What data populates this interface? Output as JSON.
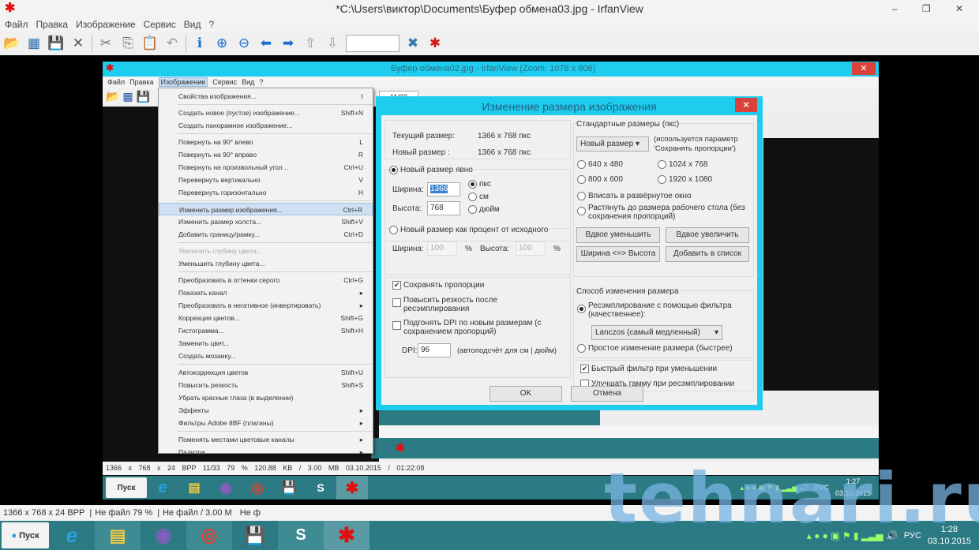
{
  "window": {
    "title": "*C:\\Users\\виктор\\Documents\\Буфер обмена03.jpg - IrfanView",
    "controls": "– ❐ ✕"
  },
  "menubar": [
    "Файл",
    "Правка",
    "Изображение",
    "Сервис",
    "Вид",
    "?"
  ],
  "toolbar": {
    "icons": [
      "open-icon",
      "thumbnails-icon",
      "save-icon",
      "delete-icon",
      "cut-icon",
      "copy-icon",
      "paste-icon",
      "undo-icon",
      "info-icon",
      "zoom-in-icon",
      "zoom-out-icon",
      "prev-icon",
      "next-icon",
      "first-page-icon",
      "last-page-icon"
    ],
    "page_value": ""
  },
  "inner": {
    "title": "Буфер обмена02.jpg - IrfanView (Zoom: 1078 x 606)",
    "menubar": [
      "Файл",
      "Правка",
      "Изображение",
      "Сервис",
      "Вид",
      "?"
    ],
    "page": "11/33",
    "status": "1366 x 768 x 24 BPP   11/33   79 %   120.88 KB / 3.00 MB   03.10.2015 / 01:22:08",
    "tray_lang": "РУС",
    "tray_time": "1:27",
    "tray_date": "03.10.2015"
  },
  "image_menu": [
    {
      "label": "Свойства изображения...",
      "shortcut": "I"
    },
    {
      "sep": true
    },
    {
      "label": "Создать новое (пустое) изображение...",
      "shortcut": "Shift+N"
    },
    {
      "label": "Создать панорамное изображение...",
      "shortcut": ""
    },
    {
      "sep": true
    },
    {
      "label": "Повернуть на 90° влево",
      "shortcut": "L"
    },
    {
      "label": "Повернуть на 90° вправо",
      "shortcut": "R"
    },
    {
      "label": "Повернуть на произвольный угол...",
      "shortcut": "Ctrl+U"
    },
    {
      "label": "Перевернуть вертикально",
      "shortcut": "V"
    },
    {
      "label": "Перевернуть горизонтально",
      "shortcut": "H"
    },
    {
      "sep": true
    },
    {
      "label": "Изменить размер изображения...",
      "shortcut": "Ctrl+R",
      "highlight": true
    },
    {
      "label": "Изменить размер холста...",
      "shortcut": "Shift+V"
    },
    {
      "label": "Добавить границу/рамку...",
      "shortcut": "Ctrl+D"
    },
    {
      "sep": true
    },
    {
      "label": "Увеличить глубину цвета...",
      "shortcut": "",
      "disabled": true
    },
    {
      "label": "Уменьшить глубину цвета...",
      "shortcut": ""
    },
    {
      "sep": true
    },
    {
      "label": "Преобразовать в оттенки серого",
      "shortcut": "Ctrl+G"
    },
    {
      "label": "Показать канал",
      "shortcut": "▸"
    },
    {
      "label": "Преобразовать в негативное (инвертировать)",
      "shortcut": "▸"
    },
    {
      "label": "Коррекция цветов...",
      "shortcut": "Shift+G"
    },
    {
      "label": "Гистограмма...",
      "shortcut": "Shift+H"
    },
    {
      "label": "Заменить цвет...",
      "shortcut": ""
    },
    {
      "label": "Создать мозаику...",
      "shortcut": ""
    },
    {
      "sep": true
    },
    {
      "label": "Автокоррекция цветов",
      "shortcut": "Shift+U"
    },
    {
      "label": "Повысить резкость",
      "shortcut": "Shift+S"
    },
    {
      "label": "Убрать красные глаза (в выделении)",
      "shortcut": ""
    },
    {
      "label": "Эффекты",
      "shortcut": "▸"
    },
    {
      "label": "Фильтры Adobe 8BF (плагины)",
      "shortcut": "▸"
    },
    {
      "sep": true
    },
    {
      "label": "Поменять местами цветовые каналы",
      "shortcut": "▸"
    },
    {
      "label": "Палитра",
      "shortcut": "▸"
    }
  ],
  "dialog": {
    "title": "Изменение размера изображения",
    "close": "✕",
    "current_label": "Текущий размер:",
    "current_value": "1366  x  768  пкс",
    "new_label": "Новый размер   :",
    "new_value": "1366  x  768  пкс",
    "explicit_label": "Новый размер явно",
    "width_label": "Ширина:",
    "width_value": "1366",
    "height_label": "Высота:",
    "height_value": "768",
    "unit_px": "пкс",
    "unit_cm": "см",
    "unit_in": "дюйм",
    "percent_label": "Новый размер как процент от исходного",
    "pwidth_label": "Ширина:",
    "pwidth_value": "100",
    "pct": "%",
    "pheight_label": "Высота:",
    "pheight_value": "100",
    "keep_ratio": "Сохранять пропорции",
    "sharpen": "Повысить резкость после ресэмплирования",
    "dpi_fit": "Подгонять DPI по новым размерам (с сохранением пропорций)",
    "dpi_label": "DPI:",
    "dpi_value": "96",
    "dpi_note": "(автоподсчёт для см | дюйм)",
    "std_title": "Стандартные размеры (пкс)",
    "std_select": "Новый размер",
    "std_note": "(используется параметр 'Сохранять пропорции')",
    "s640": "640 x 480",
    "s1024": "1024 x 768",
    "s800": "800 x 600",
    "s1920": "1920 x 1080",
    "fit_window": "Вписать в развёрнутое окно",
    "stretch_desktop": "Растянуть до размера рабочего стола (без сохранения пропорций)",
    "half": "Вдвое уменьшить",
    "double": "Вдвое увеличить",
    "swap": "Ширина <=> Высота",
    "add_list": "Добавить в список",
    "method_title": "Способ изменения размера",
    "resample": "Ресэмплирование с помощью фильтра (качественнее):",
    "filter": "Lanczos (самый медленный)",
    "simple": "Простое изменение размера (быстрее)",
    "fast_filter": "Быстрый фильтр при уменьшении",
    "gamma": "Улучшать гамму при ресэмплировании",
    "ok": "OK",
    "cancel": "Отмена"
  },
  "status": {
    "dims": "1366 x 768 x 24 BPP",
    "zoom": "Не файл 79 %",
    "size": "Не файл / 3.00 M",
    "date": "Не ф"
  },
  "taskbar": {
    "start": "Пуск",
    "skype": "S",
    "lang": "РУС",
    "time": "1:28",
    "date": "03.10.2015"
  },
  "watermark": "tehnari.ru",
  "colors": {
    "accent": "#1ecdee",
    "taskbar": "#2c7b84",
    "close": "#d9413b"
  }
}
